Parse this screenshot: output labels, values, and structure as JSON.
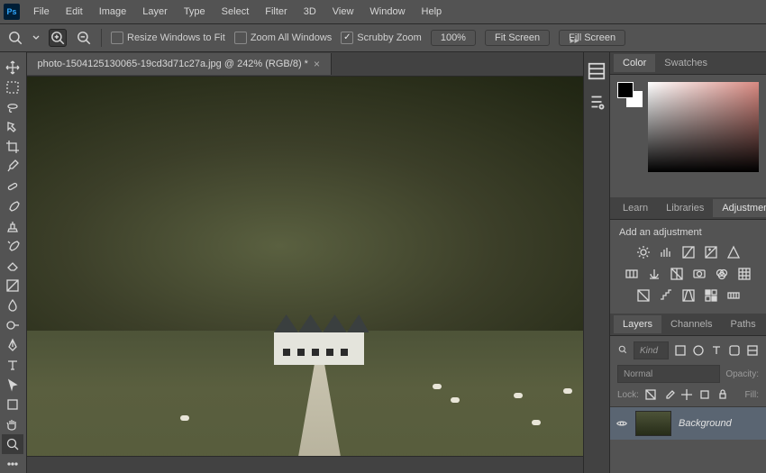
{
  "menu": {
    "items": [
      "File",
      "Edit",
      "Image",
      "Layer",
      "Type",
      "Select",
      "Filter",
      "3D",
      "View",
      "Window",
      "Help"
    ]
  },
  "options_bar": {
    "resize_windows": "Resize Windows to Fit",
    "zoom_all": "Zoom All Windows",
    "scrubby": "Scrubby Zoom",
    "zoom_pct": "100%",
    "fit_screen": "Fit Screen",
    "fill_screen": "Fill Screen"
  },
  "document": {
    "tab_label": "photo-1504125130065-19cd3d71c27a.jpg @ 242%  (RGB/8) *"
  },
  "panels": {
    "color": {
      "tabs": [
        "Color",
        "Swatches"
      ],
      "active": 0,
      "fg": "#000000",
      "bg": "#ffffff"
    },
    "adjustments": {
      "tabs": [
        "Learn",
        "Libraries",
        "Adjustments"
      ],
      "active": 2,
      "title": "Add an adjustment"
    },
    "layers": {
      "tabs": [
        "Layers",
        "Channels",
        "Paths"
      ],
      "active": 0,
      "kind_placeholder": "Kind",
      "blend_mode": "Normal",
      "opacity_label": "Opacity:",
      "lock_label": "Lock:",
      "fill_label": "Fill:",
      "layer_name": "Background"
    }
  }
}
